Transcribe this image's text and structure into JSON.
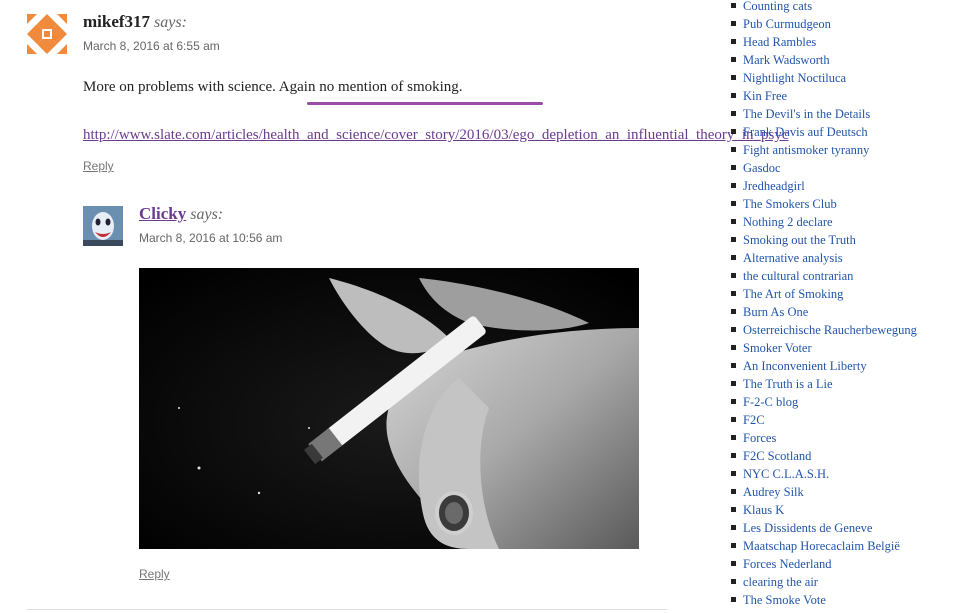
{
  "comments": [
    {
      "author": "mikef317",
      "says": "says:",
      "date": "March 8, 2016 at 6:55 am",
      "text": "More on problems with science. Again no mention of smoking.",
      "link": "http://www.slate.com/articles/health_and_science/cover_story/2016/03/ego_depletion_an_influential_theory_in_psyc",
      "reply": "Reply"
    },
    {
      "author": "Clicky",
      "says": "says:",
      "date": "March 8, 2016 at 10:56 am",
      "reply": "Reply"
    }
  ],
  "sidebar": {
    "links": [
      "Counting cats",
      "Pub Curmudgeon",
      "Head Rambles",
      "Mark Wadsworth",
      "Nightlight Noctiluca",
      "Kin Free",
      "The Devil's in the Details",
      "Frank Davis auf Deutsch",
      "Fight antismoker tyranny",
      "Gasdoc",
      "Jredheadgirl",
      "The Smokers Club",
      "Nothing 2 declare",
      "Smoking out the Truth",
      "Alternative analysis",
      "the cultural contrarian",
      "The Art of Smoking",
      "Burn As One",
      "Osterreichische Raucherbewegung",
      "Smoker Voter",
      "An Inconvenient Liberty",
      "The Truth is a Lie",
      "F-2-C blog",
      "F2C",
      "Forces",
      "F2C Scotland",
      "NYC C.L.A.S.H.",
      "Audrey Silk",
      "Klaus K",
      "Les Dissidents de Geneve",
      "Maatschap Horecaclaim België",
      "Forces Nederland",
      "clearing the air",
      "The Smoke Vote"
    ]
  },
  "colors": {
    "link_purple": "#6a3b8f",
    "sidebar_link": "#2255aa",
    "highlight_mark": "#9a4ca6",
    "identicon": "#f08a3c"
  },
  "icons": {
    "avatar1": "identicon-avatar",
    "avatar2": "clown-face-avatar",
    "photo": "hand-holding-cigarette-photo"
  }
}
